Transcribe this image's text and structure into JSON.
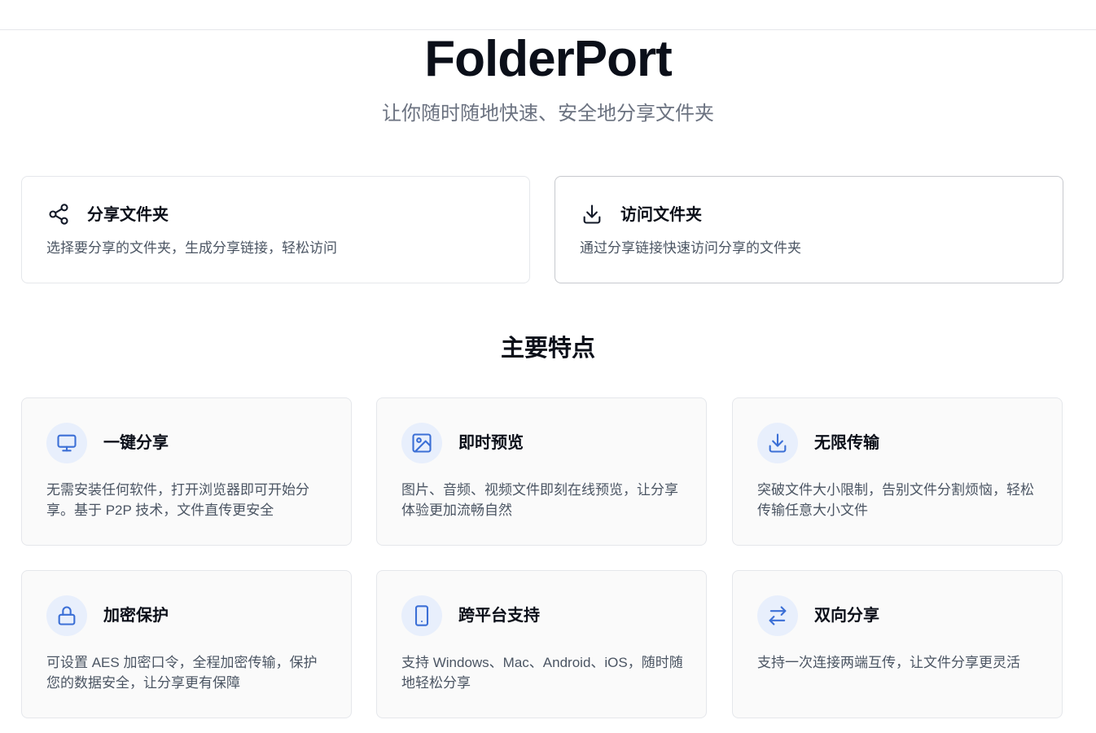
{
  "hero": {
    "title": "FolderPort",
    "subtitle": "让你随时随地快速、安全地分享文件夹"
  },
  "actions": [
    {
      "icon": "share-icon",
      "title": "分享文件夹",
      "description": "选择要分享的文件夹，生成分享链接，轻松访问"
    },
    {
      "icon": "download-icon",
      "title": "访问文件夹",
      "description": "通过分享链接快速访问分享的文件夹"
    }
  ],
  "features_section": {
    "title": "主要特点",
    "items": [
      {
        "icon": "monitor-icon",
        "title": "一键分享",
        "description": "无需安装任何软件，打开浏览器即可开始分享。基于 P2P 技术，文件直传更安全"
      },
      {
        "icon": "image-icon",
        "title": "即时预览",
        "description": "图片、音频、视频文件即刻在线预览，让分享体验更加流畅自然"
      },
      {
        "icon": "download-icon",
        "title": "无限传输",
        "description": "突破文件大小限制，告别文件分割烦恼，轻松传输任意大小文件"
      },
      {
        "icon": "lock-icon",
        "title": "加密保护",
        "description": "可设置 AES 加密口令，全程加密传输，保护您的数据安全，让分享更有保障"
      },
      {
        "icon": "mobile-icon",
        "title": "跨平台支持",
        "description": "支持 Windows、Mac、Android、iOS，随时随地轻松分享"
      },
      {
        "icon": "swap-arrows-icon",
        "title": "双向分享",
        "description": "支持一次连接两端互传，让文件分享更灵活"
      }
    ]
  },
  "colors": {
    "accent": "#3b6fd6",
    "icon_bg": "#e8effc",
    "text_primary": "#0b0f19",
    "text_secondary": "#4b5563"
  }
}
